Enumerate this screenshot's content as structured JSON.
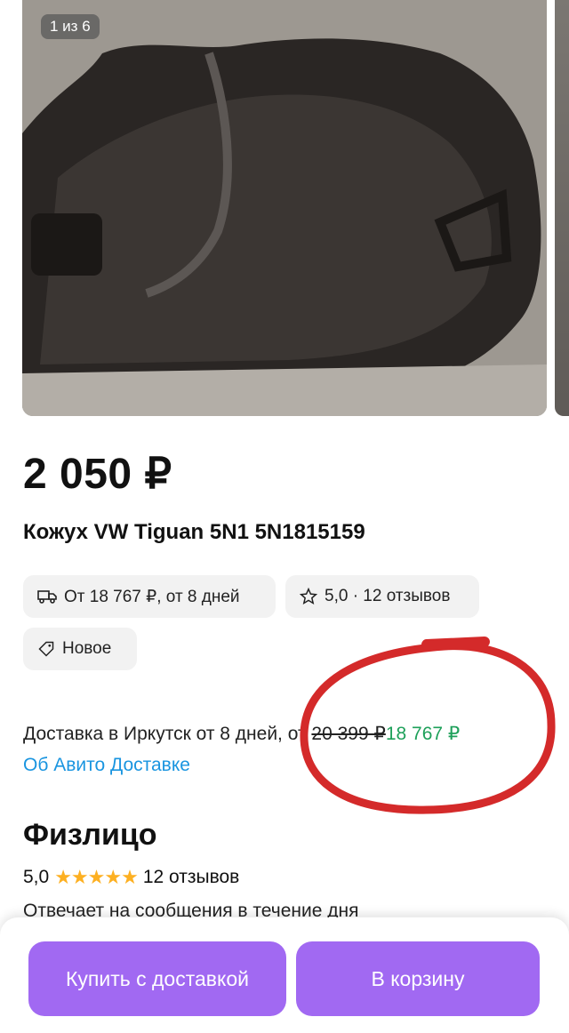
{
  "gallery": {
    "counter": "1 из 6"
  },
  "product": {
    "price": "2 050 ₽",
    "title": "Кожух VW Tiguan 5N1 5N1815159"
  },
  "chips": {
    "delivery": "От 18 767 ₽, от 8 дней",
    "delivery_icon": "truck-icon",
    "rating": "5,0 · 12 отзывов",
    "rating_icon": "star-outline-icon",
    "condition": "Новое",
    "condition_icon": "tag-icon"
  },
  "delivery": {
    "text": "Доставка в Иркутск от 8 дней, от",
    "old_price": "20 399 ₽",
    "new_price": "18 767 ₽",
    "link": "Об Авито Доставке"
  },
  "seller": {
    "name": "Физлицо",
    "rating": "5,0",
    "stars": 5,
    "reviews": "12 отзывов",
    "response_time": "Отвечает на сообщения в течение дня"
  },
  "actions": {
    "buy": "Купить с доставкой",
    "cart": "В корзину"
  },
  "colors": {
    "accent": "#a169f2",
    "new_price": "#1ea05a",
    "link": "#1a95e0",
    "annotation": "#d42a2a"
  }
}
